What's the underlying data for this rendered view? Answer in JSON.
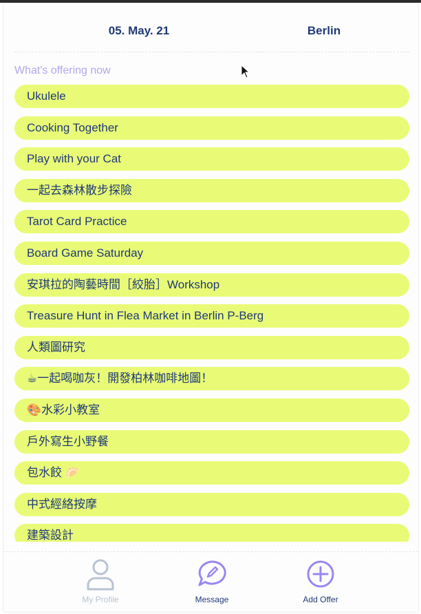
{
  "header": {
    "date": "05. May. 21",
    "city": "Berlin"
  },
  "section": {
    "title": "What's offering now"
  },
  "offers": [
    "Ukulele",
    "Cooking Together",
    "Play with your Cat",
    "一起去森林散步探險",
    "Tarot Card Practice",
    "Board Game Saturday",
    "安琪拉的陶藝時間［絞胎］Workshop",
    "Treasure Hunt in Flea Market in Berlin P-Berg",
    "人類圖研究",
    "☕一起喝咖灰！開發柏林咖啡地圖！",
    "🎨水彩小教室",
    "戶外寫生小野餐",
    "包水餃 🥟",
    "中式經絡按摩",
    "建築設計"
  ],
  "nav": {
    "profile_label": "My Profile",
    "message_label": "Message",
    "add_offer_label": "Add Offer"
  },
  "colors": {
    "offer_background": "#e9fb76",
    "text_primary": "#1f3a78",
    "accent_purple": "#9a86f2",
    "muted": "#b8c3d2"
  },
  "icons": {
    "profile": "person-icon",
    "message": "chat-pencil-icon",
    "add_offer": "plus-circle-icon"
  }
}
